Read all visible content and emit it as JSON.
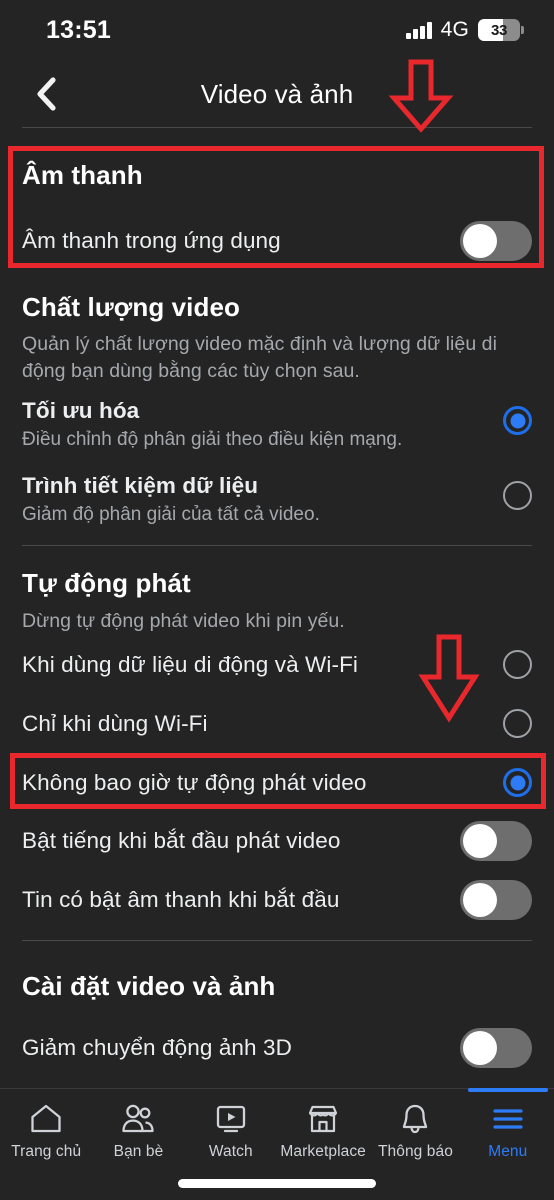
{
  "status_bar": {
    "time": "13:51",
    "network": "4G",
    "battery_percent": "33",
    "signal_icon": "signal-bars-icon",
    "battery_icon": "battery-icon"
  },
  "header": {
    "back_icon": "chevron-left-icon",
    "title": "Video và ảnh"
  },
  "sections": {
    "sound": {
      "title": "Âm thanh",
      "rows": [
        {
          "label": "Âm thanh trong ứng dụng",
          "control": "toggle",
          "state": "off"
        }
      ]
    },
    "video_quality": {
      "title": "Chất lượng video",
      "description": "Quản lý chất lượng video mặc định và lượng dữ liệu di động bạn dùng bằng các tùy chọn sau.",
      "options": [
        {
          "label": "Tối ưu hóa",
          "sub": "Điều chỉnh độ phân giải theo điều kiện mạng.",
          "control": "radio",
          "state": "on"
        },
        {
          "label": "Trình tiết kiệm dữ liệu",
          "sub": "Giảm độ phân giải của tất cả video.",
          "control": "radio",
          "state": "off"
        }
      ]
    },
    "autoplay": {
      "title": "Tự động phát",
      "description": "Dừng tự động phát video khi pin yếu.",
      "options": [
        {
          "label": "Khi dùng dữ liệu di động và Wi-Fi",
          "control": "radio",
          "state": "off"
        },
        {
          "label": "Chỉ khi dùng Wi-Fi",
          "control": "radio",
          "state": "off"
        },
        {
          "label": "Không bao giờ tự động phát video",
          "control": "radio",
          "state": "on"
        }
      ],
      "toggles": [
        {
          "label": "Bật tiếng khi bắt đầu phát video",
          "control": "toggle",
          "state": "off"
        },
        {
          "label": "Tin có bật âm thanh khi bắt đầu",
          "control": "toggle",
          "state": "off"
        }
      ]
    },
    "video_photo_settings": {
      "title": "Cài đặt video và ảnh",
      "rows": [
        {
          "label": "Giảm chuyển động ảnh 3D",
          "control": "toggle",
          "state": "off"
        }
      ]
    }
  },
  "annotations": {
    "highlight_color": "#e8282c",
    "arrow_top_icon": "down-arrow-annotation",
    "arrow_mid_icon": "down-arrow-annotation",
    "box_sound_icon": "highlight-box-annotation",
    "box_never_autoplay_icon": "highlight-box-annotation"
  },
  "bottom_nav": {
    "active_color": "#2e7bf6",
    "items": [
      {
        "label": "Trang chủ",
        "icon": "home-icon",
        "active": false
      },
      {
        "label": "Bạn bè",
        "icon": "friends-icon",
        "active": false
      },
      {
        "label": "Watch",
        "icon": "watch-play-icon",
        "active": false
      },
      {
        "label": "Marketplace",
        "icon": "marketplace-store-icon",
        "active": false
      },
      {
        "label": "Thông báo",
        "icon": "bell-icon",
        "active": false
      },
      {
        "label": "Menu",
        "icon": "hamburger-menu-icon",
        "active": true
      }
    ]
  }
}
